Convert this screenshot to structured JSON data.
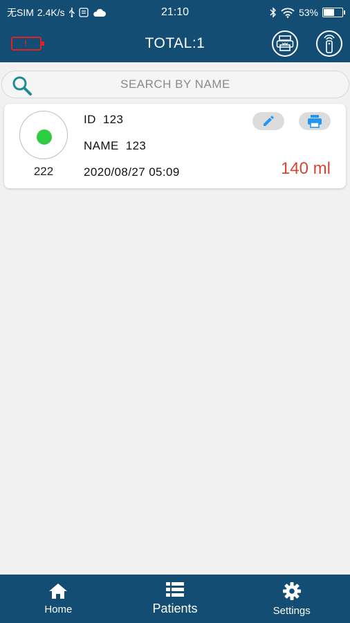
{
  "status_bar": {
    "carrier": "无SIM",
    "speed": "2.4K/s",
    "time": "21:10",
    "battery_percent": "53%"
  },
  "header": {
    "title": "TOTAL:1",
    "device_battery_level": 0.1
  },
  "search": {
    "placeholder": "SEARCH BY NAME"
  },
  "records": [
    {
      "status_color": "#2ecc40",
      "code": "222",
      "id_label": "ID",
      "id_value": "123",
      "name_label": "NAME",
      "name_value": "123",
      "datetime": "2020/08/27 05:09",
      "volume": "140 ml"
    }
  ],
  "nav": {
    "items": [
      {
        "label": "Home",
        "icon": "home-icon"
      },
      {
        "label": "Patients",
        "icon": "list-icon"
      },
      {
        "label": "Settings",
        "icon": "gear-icon"
      }
    ]
  },
  "colors": {
    "primary": "#144d73",
    "accent": "#2196f3",
    "alert": "#e02222",
    "volume": "#d9462f"
  }
}
